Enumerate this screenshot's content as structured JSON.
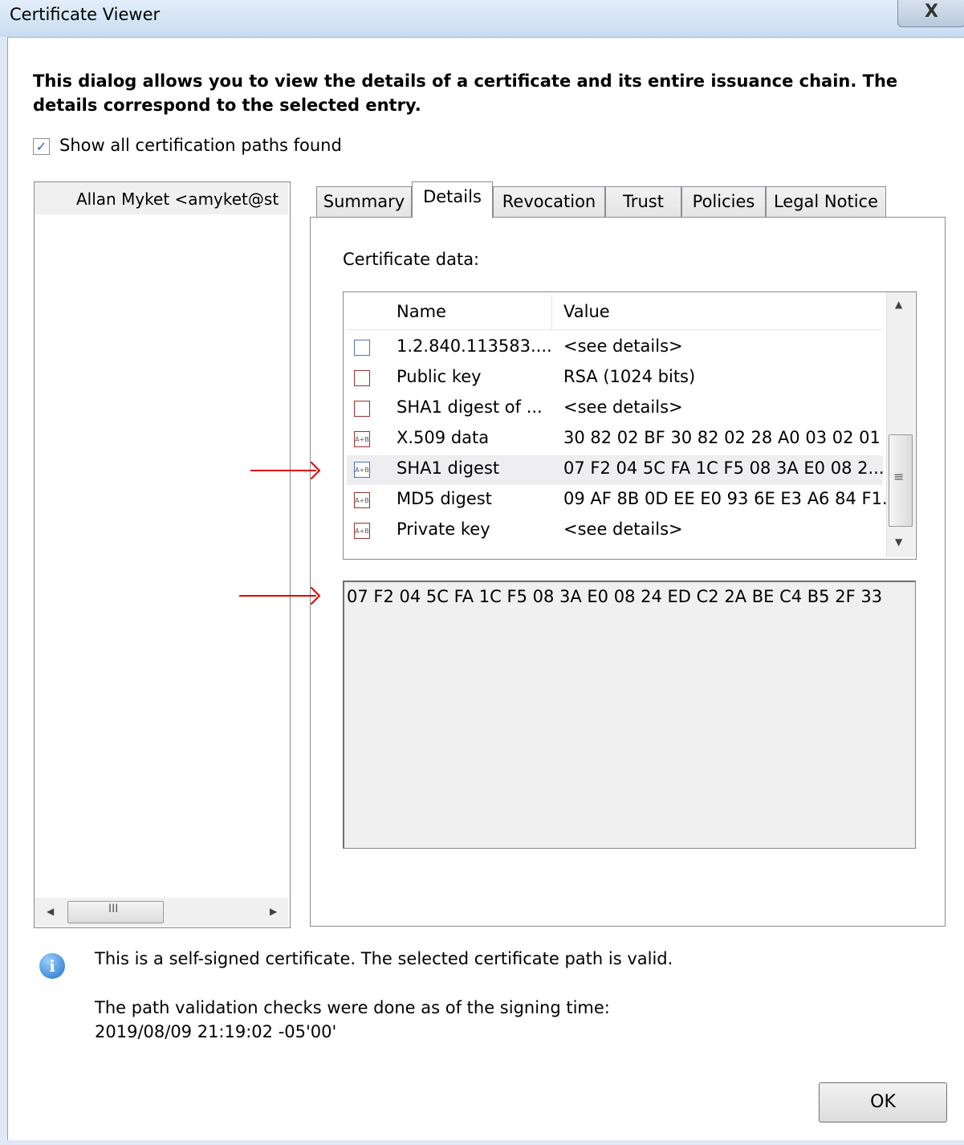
{
  "window": {
    "title": "Certificate Viewer",
    "close_label": "X"
  },
  "intro_text": "This dialog allows you to view the details of a certificate and its entire issuance chain. The details correspond to the selected entry.",
  "show_all_paths": {
    "label": "Show all certification paths found",
    "checked": true,
    "check_glyph": "✓"
  },
  "tree": {
    "items": [
      {
        "label": "Allan Myket <amyket@st"
      }
    ],
    "scroll_left": "◀",
    "scroll_grip": "III",
    "scroll_right": "▶"
  },
  "tabs": [
    {
      "label": "Summary"
    },
    {
      "label": "Details",
      "active": true
    },
    {
      "label": "Revocation"
    },
    {
      "label": "Trust"
    },
    {
      "label": "Policies"
    },
    {
      "label": "Legal Notice"
    }
  ],
  "details": {
    "certificate_data_label": "Certificate data:",
    "columns": {
      "name": "Name",
      "value": "Value"
    },
    "rows": [
      {
        "icon": "extension-icon",
        "icon_glyph": "",
        "name": "1.2.840.113583....",
        "value": "<see details>"
      },
      {
        "icon": "certificate-icon",
        "icon_glyph": "",
        "name": "Public key",
        "value": "RSA (1024 bits)"
      },
      {
        "icon": "certificate-icon",
        "icon_glyph": "",
        "name": "SHA1 digest of ...",
        "value": "<see details>"
      },
      {
        "icon": "data-field-icon",
        "icon_glyph": "A+B",
        "name": "X.509 data",
        "value": "30 82 02 BF 30 82 02 28 A0 03 02 01 ..."
      },
      {
        "icon": "data-field-icon",
        "icon_glyph": "A+B",
        "name": "SHA1 digest",
        "value": "07 F2 04 5C FA 1C F5 08 3A E0 08 2...",
        "selected": true
      },
      {
        "icon": "data-field-icon",
        "icon_glyph": "A+B",
        "name": "MD5 digest",
        "value": "09 AF 8B 0D EE E0 93 6E E3 A6 84 F1..."
      },
      {
        "icon": "data-field-icon",
        "icon_glyph": "A+B",
        "name": "Private key",
        "value": "<see details>"
      }
    ],
    "scroll_up": "▲",
    "scroll_grip": "≡",
    "scroll_down": "▼",
    "selected_value": "07 F2 04 5C FA 1C F5 08 3A E0 08 24 ED C2 2A BE C4 B5 2F 33"
  },
  "info": {
    "icon_glyph": "i",
    "line1": "This is a self-signed certificate. The selected certificate path is valid.",
    "line2": "The path validation checks were done as of the signing time:",
    "line3": "2019/08/09 21:19:02 -05'00'"
  },
  "ok_label": "OK",
  "colors": {
    "annotation_arrow": "#e00000",
    "selection": "#eeeef0",
    "titlebar": "#c9dcf0"
  }
}
